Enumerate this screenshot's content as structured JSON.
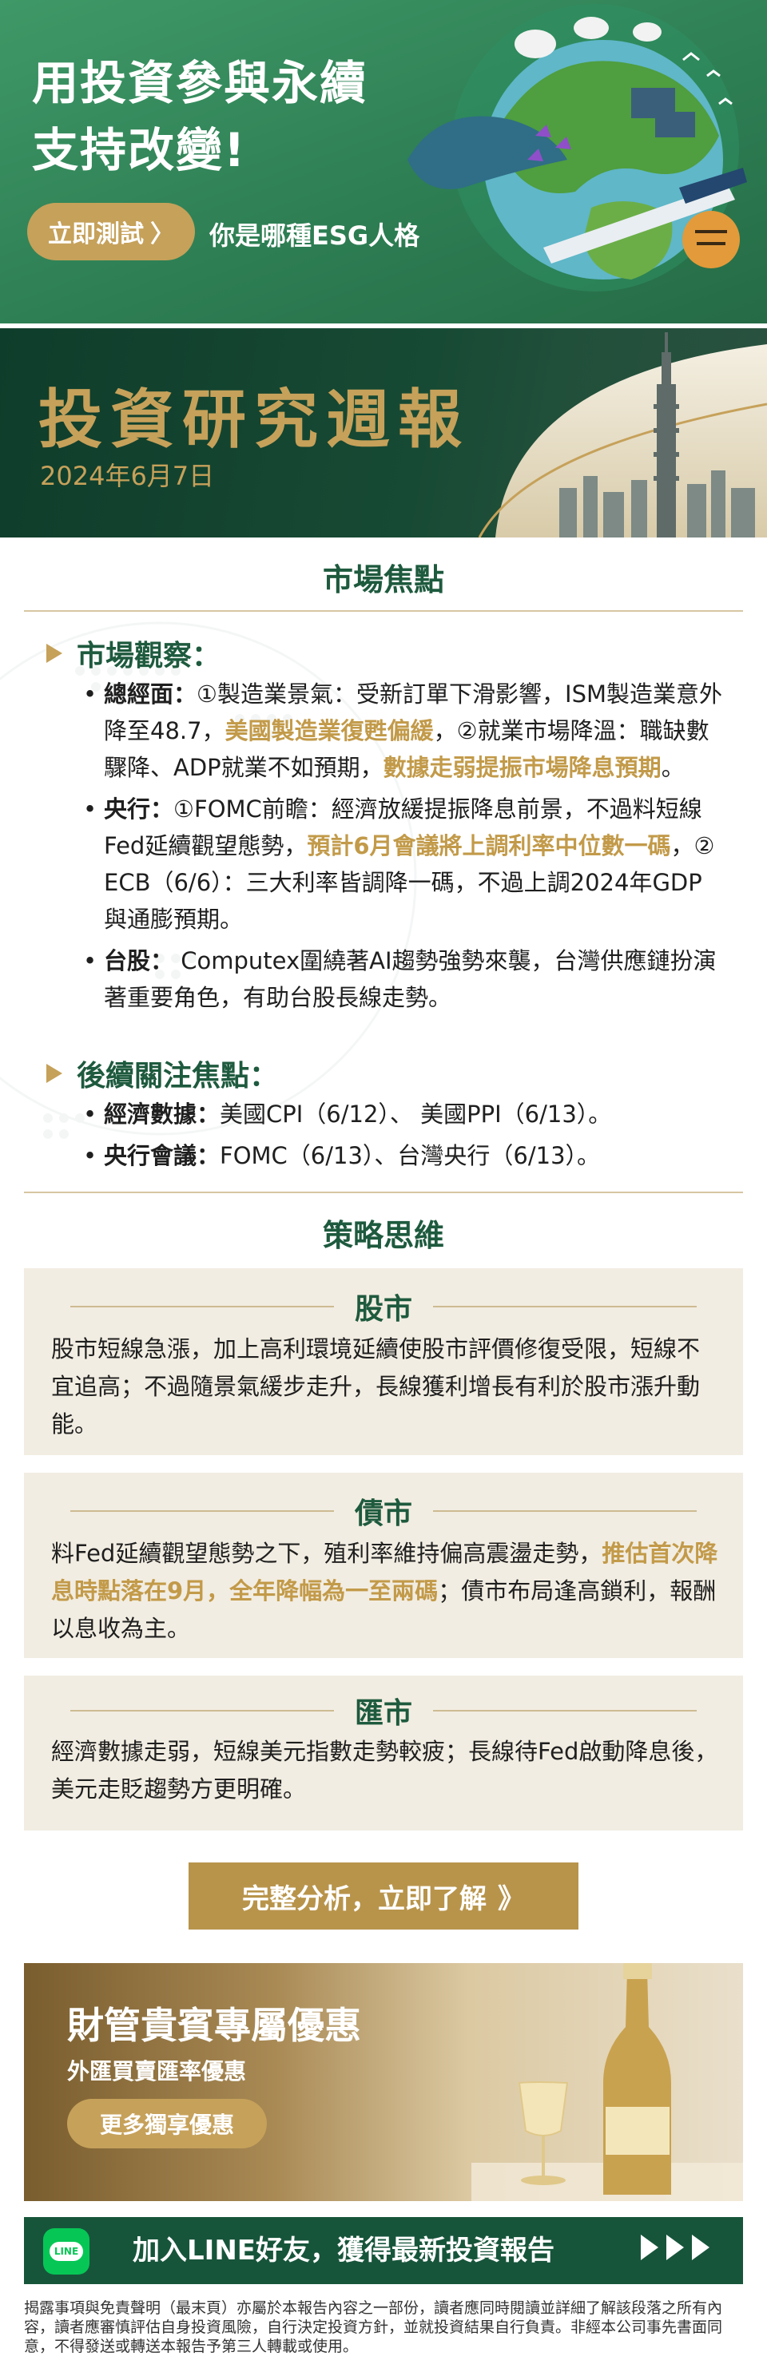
{
  "esg_banner": {
    "title_line1": "用投資參與永續",
    "title_line2": "支持改變!",
    "cta_label": "立即測試",
    "cta_arrow": "〉",
    "subtitle": "你是哪種ESG人格"
  },
  "report_header": {
    "title": "投資研究週報",
    "date": "2024年6月7日"
  },
  "market_focus": {
    "heading": "市場焦點",
    "observation": {
      "title": "市場觀察：",
      "items": [
        {
          "label": "總經面：",
          "text_a": "①製造業景氣：受新訂單下滑影響，ISM製造業意外降至48.7，",
          "highlight_a": "美國製造業復甦偏緩",
          "text_b": "，②就業市場降溫：職缺數驟降、ADP就業不如預期，",
          "highlight_b": "數據走弱提振市場降息預期",
          "text_c": "。"
        },
        {
          "label": "央行：",
          "text_a": "①FOMC前瞻：經濟放緩提振降息前景，不過料短線Fed延續觀望態勢，",
          "highlight_a": "預計6月會議將上調利率中位數一碼",
          "text_b": "，② ECB（6/6）：三大利率皆調降一碼，不過上調2024年GDP與通膨預期。"
        },
        {
          "label": "台股：",
          "text_a": " Computex圍繞著AI趨勢強勢來襲，台灣供應鏈扮演著重要角色，有助台股長線走勢。"
        }
      ]
    },
    "followup": {
      "title": "後續關注焦點：",
      "items": [
        {
          "label": "經濟數據：",
          "text": "美國CPI（6/12）、 美國PPI（6/13）。"
        },
        {
          "label": "央行會議：",
          "text": "FOMC（6/13）、台灣央行（6/13）。"
        }
      ]
    }
  },
  "strategy": {
    "heading": "策略思維",
    "cards": [
      {
        "title": "股市",
        "text_a": "股市短線急漲，加上高利環境延續使股市評價修復受限，短線不宜追高；不過隨景氣緩步走升，長線獲利增長有利於股市漲升動能。"
      },
      {
        "title": "債市",
        "text_a": "料Fed延續觀望態勢之下，殖利率維持偏高震盪走勢，",
        "highlight": "推估首次降息時點落在9月，全年降幅為一至兩碼",
        "text_b": "；債市布局逢高鎖利，報酬以息收為主。"
      },
      {
        "title": "匯市",
        "text_a": "經濟數據走弱，短線美元指數走勢較疲；長線待Fed啟動降息後，美元走貶趨勢方更明確。"
      }
    ]
  },
  "cta": {
    "label": "完整分析，立即了解",
    "arrow": "》"
  },
  "promo": {
    "title": "財管貴賓專屬優惠",
    "subtitle": "外匯買賣匯率優惠",
    "button": "更多獨享優惠"
  },
  "line_bar": {
    "icon_text": "LINE",
    "label": "加入LINE好友，獲得最新投資報告"
  },
  "disclaimer": "揭露事項與免責聲明（最末頁）亦屬於本報告內容之一部份，讀者應同時閱讀並詳細了解該段落之所有內容，讀者應審慎評估自身投資風險，自行決定投資方針，並就投資結果自行負責。非經本公司事先書面同意，不得發送或轉送本報告予第三人轉載或使用。",
  "colors": {
    "brand_green": "#1e5a3e",
    "gold": "#c6a15a",
    "highlight_gold": "#c29a49",
    "card_bg": "#f2ede2",
    "line_green": "#06c755"
  }
}
